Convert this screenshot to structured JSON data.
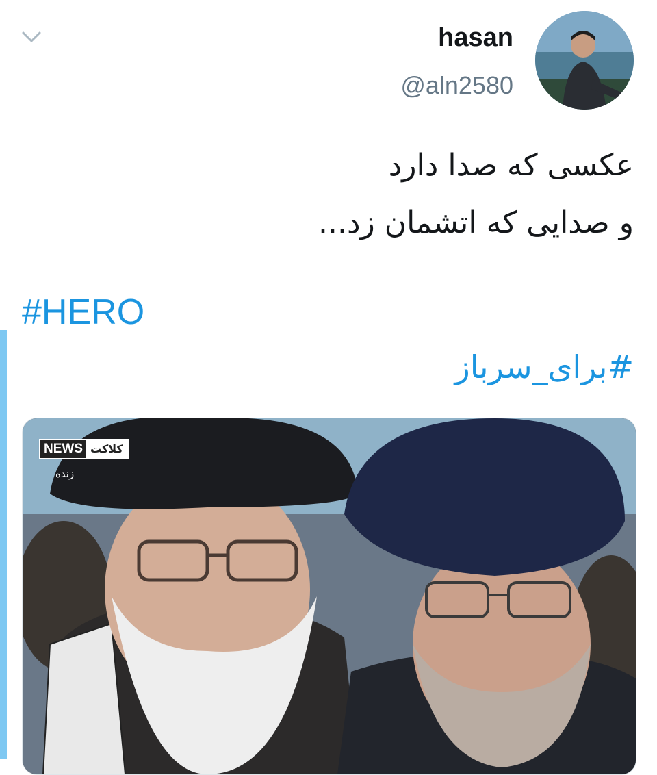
{
  "author": {
    "display_name": "hasan",
    "handle": "@aln2580",
    "avatar_icon": "user-avatar-photo"
  },
  "menu": {
    "icon": "chevron-down-icon"
  },
  "tweet": {
    "text_lines": [
      "عکسی که صدا دارد",
      "و صدایی که اتشمان زد..."
    ],
    "hashtags": [
      "#HERO",
      "#برای_سرباز"
    ]
  },
  "media": {
    "overlay_brand_news": "NEWS",
    "overlay_brand_name": "کلاکت",
    "overlay_live": "زنده"
  },
  "colors": {
    "link": "#1b95e0",
    "handle": "#657786",
    "text": "#14171a",
    "accent_bar": "#7ec8f2"
  }
}
